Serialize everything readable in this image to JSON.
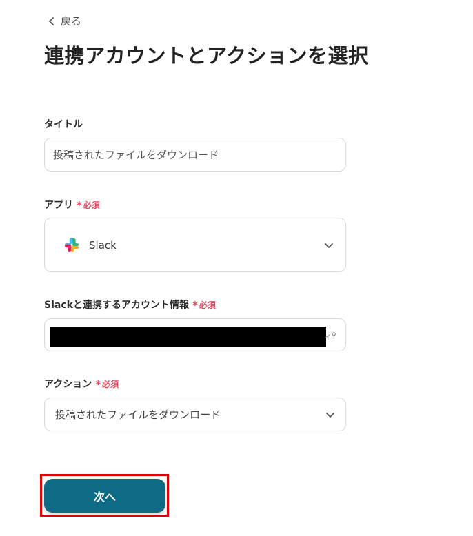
{
  "header": {
    "back_label": "戻る",
    "title": "連携アカウントとアクションを選択"
  },
  "form": {
    "title_field": {
      "label": "タイトル",
      "value": "投稿されたファイルをダウンロード"
    },
    "app_field": {
      "label": "アプリ",
      "required_star": "*",
      "required_text": "必須",
      "value": "Slack",
      "icon": "slack-logo"
    },
    "account_field": {
      "label": "Slackと連携するアカウント情報",
      "required_star": "*",
      "required_text": "必須",
      "value_tail": "ィŸ"
    },
    "action_field": {
      "label": "アクション",
      "required_star": "*",
      "required_text": "必須",
      "value": "投稿されたファイルをダウンロード"
    }
  },
  "footer": {
    "next_label": "次へ"
  },
  "colors": {
    "primary": "#0e6a85",
    "required": "#e04a5f",
    "highlight": "#e00000"
  }
}
